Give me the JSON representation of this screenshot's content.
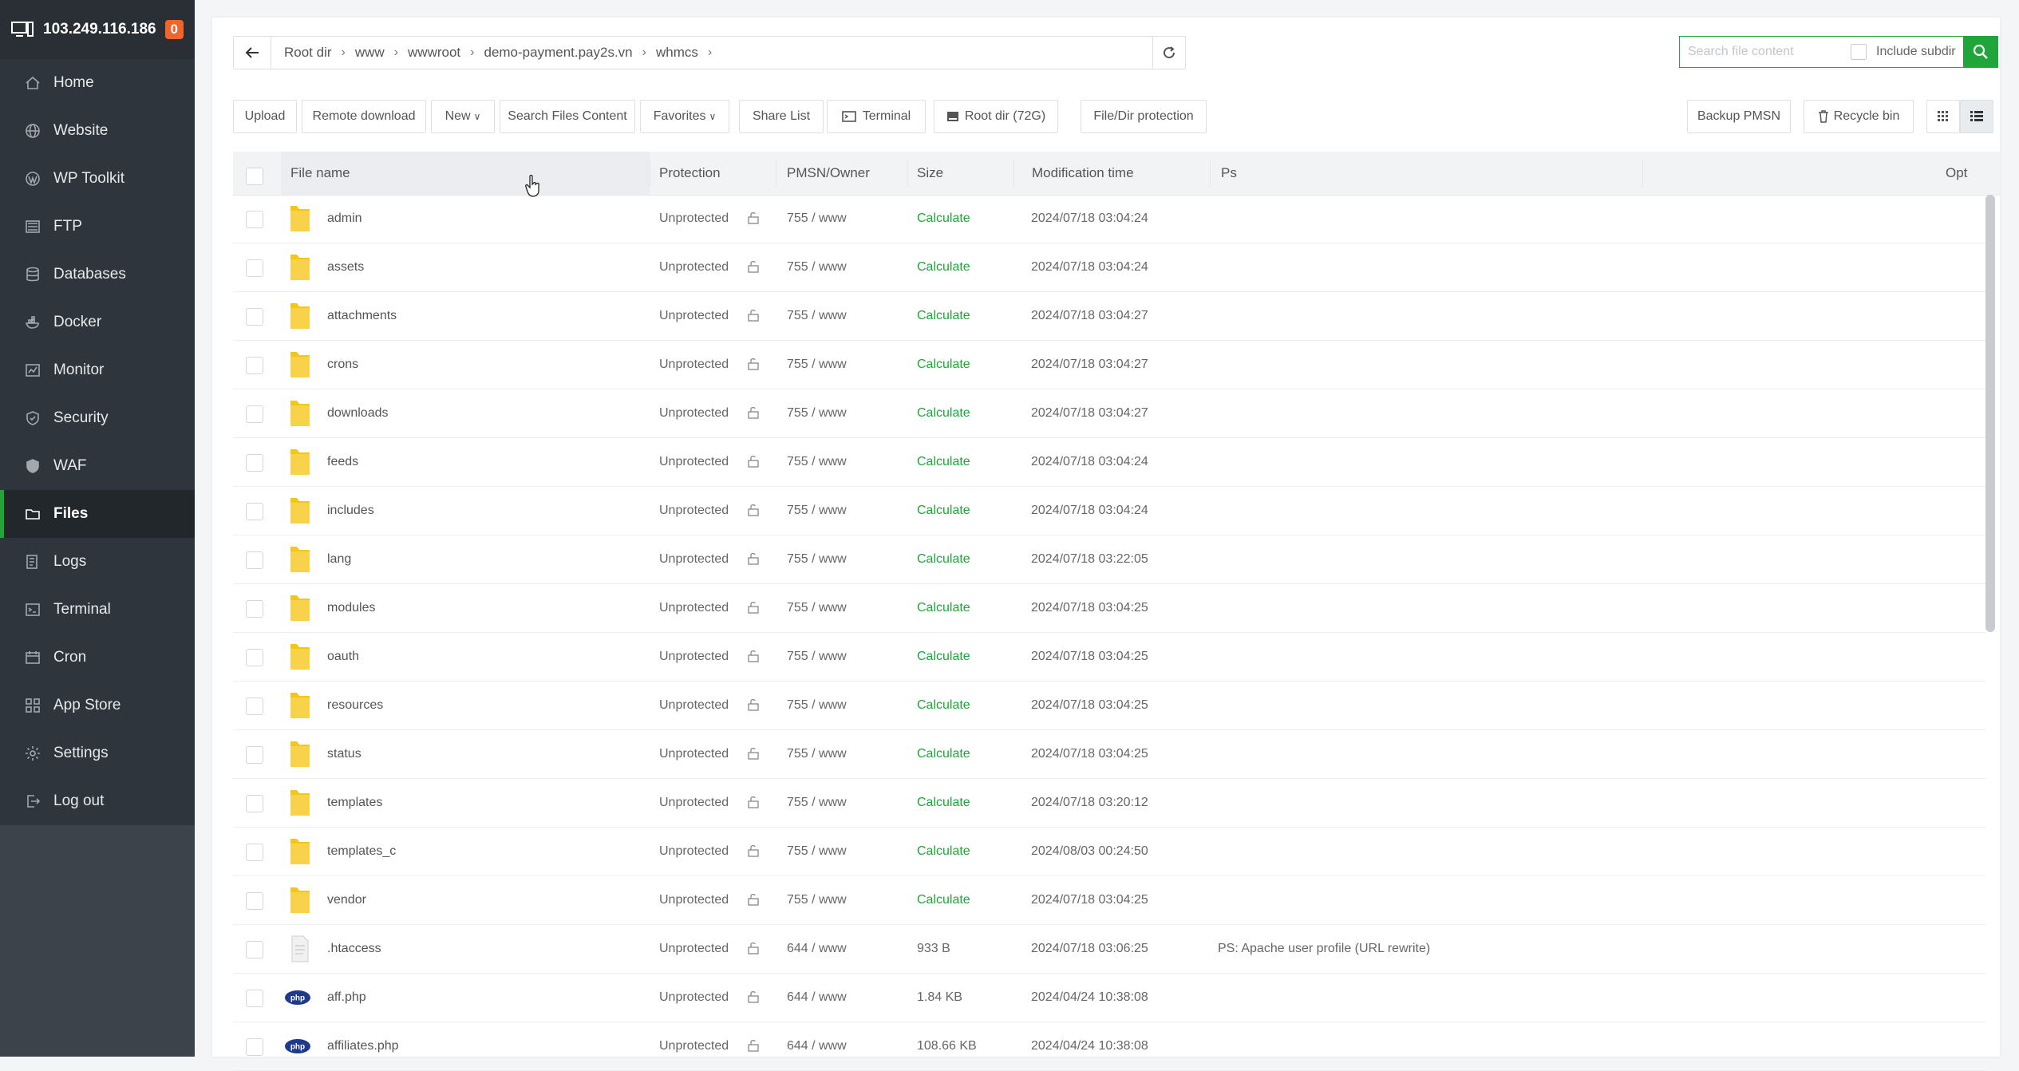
{
  "server": {
    "ip": "103.249.116.186",
    "badge": "0"
  },
  "sidebar": {
    "items": [
      {
        "label": "Home",
        "icon": "home-icon",
        "active": false
      },
      {
        "label": "Website",
        "icon": "globe-icon",
        "active": false
      },
      {
        "label": "WP Toolkit",
        "icon": "wordpress-icon",
        "active": false
      },
      {
        "label": "FTP",
        "icon": "ftp-icon",
        "active": false
      },
      {
        "label": "Databases",
        "icon": "database-icon",
        "active": false
      },
      {
        "label": "Docker",
        "icon": "docker-icon",
        "active": false
      },
      {
        "label": "Monitor",
        "icon": "monitor-icon",
        "active": false
      },
      {
        "label": "Security",
        "icon": "shield-icon",
        "active": false
      },
      {
        "label": "WAF",
        "icon": "waf-icon",
        "active": false
      },
      {
        "label": "Files",
        "icon": "folder-icon",
        "active": true
      },
      {
        "label": "Logs",
        "icon": "logs-icon",
        "active": false
      },
      {
        "label": "Terminal",
        "icon": "terminal-icon",
        "active": false
      },
      {
        "label": "Cron",
        "icon": "cron-icon",
        "active": false
      },
      {
        "label": "App Store",
        "icon": "apps-icon",
        "active": false
      },
      {
        "label": "Settings",
        "icon": "gear-icon",
        "active": false
      },
      {
        "label": "Log out",
        "icon": "logout-icon",
        "active": false
      }
    ]
  },
  "path": {
    "crumbs": [
      "Root dir",
      "www",
      "wwwroot",
      "demo-payment.pay2s.vn",
      "whmcs"
    ]
  },
  "search": {
    "placeholder": "Search file content",
    "include_subdir_label": "Include subdir"
  },
  "toolbar": {
    "upload": "Upload",
    "remote_download": "Remote download",
    "new": "New",
    "search_files_content": "Search Files Content",
    "favorites": "Favorites",
    "share_list": "Share List",
    "terminal": "Terminal",
    "root_dir": "Root dir (72G)",
    "file_dir_protection": "File/Dir protection",
    "backup_pmsn": "Backup PMSN",
    "recycle_bin": "Recycle bin"
  },
  "table": {
    "headers": {
      "name": "File name",
      "protection": "Protection",
      "owner": "PMSN/Owner",
      "size": "Size",
      "mtime": "Modification time",
      "ps": "Ps",
      "opt": "Opt"
    },
    "rows": [
      {
        "name": "admin",
        "type": "folder",
        "protection": "Unprotected",
        "owner": "755 / www",
        "size": "Calculate",
        "mtime": "2024/07/18 03:04:24",
        "ps": ""
      },
      {
        "name": "assets",
        "type": "folder",
        "protection": "Unprotected",
        "owner": "755 / www",
        "size": "Calculate",
        "mtime": "2024/07/18 03:04:24",
        "ps": ""
      },
      {
        "name": "attachments",
        "type": "folder",
        "protection": "Unprotected",
        "owner": "755 / www",
        "size": "Calculate",
        "mtime": "2024/07/18 03:04:27",
        "ps": ""
      },
      {
        "name": "crons",
        "type": "folder",
        "protection": "Unprotected",
        "owner": "755 / www",
        "size": "Calculate",
        "mtime": "2024/07/18 03:04:27",
        "ps": ""
      },
      {
        "name": "downloads",
        "type": "folder",
        "protection": "Unprotected",
        "owner": "755 / www",
        "size": "Calculate",
        "mtime": "2024/07/18 03:04:27",
        "ps": ""
      },
      {
        "name": "feeds",
        "type": "folder",
        "protection": "Unprotected",
        "owner": "755 / www",
        "size": "Calculate",
        "mtime": "2024/07/18 03:04:24",
        "ps": ""
      },
      {
        "name": "includes",
        "type": "folder",
        "protection": "Unprotected",
        "owner": "755 / www",
        "size": "Calculate",
        "mtime": "2024/07/18 03:04:24",
        "ps": ""
      },
      {
        "name": "lang",
        "type": "folder",
        "protection": "Unprotected",
        "owner": "755 / www",
        "size": "Calculate",
        "mtime": "2024/07/18 03:22:05",
        "ps": ""
      },
      {
        "name": "modules",
        "type": "folder",
        "protection": "Unprotected",
        "owner": "755 / www",
        "size": "Calculate",
        "mtime": "2024/07/18 03:04:25",
        "ps": ""
      },
      {
        "name": "oauth",
        "type": "folder",
        "protection": "Unprotected",
        "owner": "755 / www",
        "size": "Calculate",
        "mtime": "2024/07/18 03:04:25",
        "ps": ""
      },
      {
        "name": "resources",
        "type": "folder",
        "protection": "Unprotected",
        "owner": "755 / www",
        "size": "Calculate",
        "mtime": "2024/07/18 03:04:25",
        "ps": ""
      },
      {
        "name": "status",
        "type": "folder",
        "protection": "Unprotected",
        "owner": "755 / www",
        "size": "Calculate",
        "mtime": "2024/07/18 03:04:25",
        "ps": ""
      },
      {
        "name": "templates",
        "type": "folder",
        "protection": "Unprotected",
        "owner": "755 / www",
        "size": "Calculate",
        "mtime": "2024/07/18 03:20:12",
        "ps": ""
      },
      {
        "name": "templates_c",
        "type": "folder",
        "protection": "Unprotected",
        "owner": "755 / www",
        "size": "Calculate",
        "mtime": "2024/08/03 00:24:50",
        "ps": ""
      },
      {
        "name": "vendor",
        "type": "folder",
        "protection": "Unprotected",
        "owner": "755 / www",
        "size": "Calculate",
        "mtime": "2024/07/18 03:04:25",
        "ps": ""
      },
      {
        "name": ".htaccess",
        "type": "file",
        "protection": "Unprotected",
        "owner": "644 / www",
        "size": "933 B",
        "mtime": "2024/07/18 03:06:25",
        "ps": "PS: Apache user profile (URL rewrite)"
      },
      {
        "name": "aff.php",
        "type": "php",
        "protection": "Unprotected",
        "owner": "644 / www",
        "size": "1.84 KB",
        "mtime": "2024/04/24 10:38:08",
        "ps": ""
      },
      {
        "name": "affiliates.php",
        "type": "php",
        "protection": "Unprotected",
        "owner": "644 / www",
        "size": "108.66 KB",
        "mtime": "2024/04/24 10:38:08",
        "ps": ""
      }
    ]
  },
  "colors": {
    "accent": "#20a53a",
    "sidebar": "#3c434b",
    "badge": "#f0652c",
    "folder": "#f5c518",
    "php": "#1f3a8a"
  }
}
